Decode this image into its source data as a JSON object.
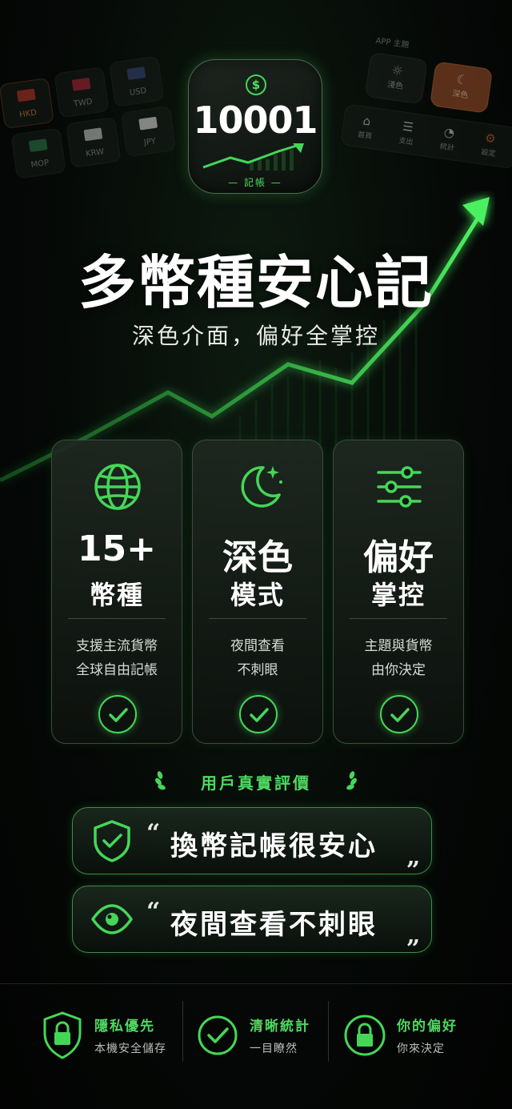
{
  "currencies": [
    {
      "code": "HKD",
      "flag_color": "#c0392b"
    },
    {
      "code": "TWD",
      "flag_color": "#b22a3a"
    },
    {
      "code": "USD",
      "flag_color": "#3a4a7a"
    },
    {
      "code": "MOP",
      "flag_color": "#2f7d4a"
    },
    {
      "code": "KRW",
      "flag_color": "#cfcfcf"
    },
    {
      "code": "JPY",
      "flag_color": "#e8e8e8"
    }
  ],
  "settings_panel": {
    "title": "APP 主題",
    "theme_light": "淺色",
    "theme_dark": "深色",
    "nav": [
      "首頁",
      "支出",
      "統計",
      "設定"
    ]
  },
  "app_icon": {
    "number": "10001",
    "label": "— 記帳 —"
  },
  "headline": "多幣種安心記",
  "subline": "深色介面，偏好全掌控",
  "features": [
    {
      "big": "15+",
      "mid": "幣種",
      "desc1": "支援主流貨幣",
      "desc2": "全球自由記帳",
      "icon": "globe-icon"
    },
    {
      "big": "深色",
      "mid": "模式",
      "desc1": "夜間查看",
      "desc2": "不刺眼",
      "icon": "moon-icon"
    },
    {
      "big": "偏好",
      "mid": "掌控",
      "desc1": "主題與貨幣",
      "desc2": "由你決定",
      "icon": "sliders-icon"
    }
  ],
  "reviews_title": "用戶真實評價",
  "reviews": [
    {
      "open_quote": "“",
      "text": "換幣記帳很安心",
      "close_quote": "”",
      "icon": "shield-check-icon"
    },
    {
      "open_quote": "“",
      "text": "夜間查看不刺眼",
      "close_quote": "”",
      "icon": "eye-icon"
    }
  ],
  "footer": [
    {
      "title": "隱私優先",
      "sub": "本機安全儲存",
      "icon": "lock-shield-icon"
    },
    {
      "title": "清晰統計",
      "sub": "一目瞭然",
      "icon": "check-circle-icon"
    },
    {
      "title": "你的偏好",
      "sub": "你來決定",
      "icon": "lock-circle-icon"
    }
  ],
  "colors": {
    "accent_green": "#45d658",
    "background": "#050806",
    "dark_theme_orange": "#a0512a"
  }
}
